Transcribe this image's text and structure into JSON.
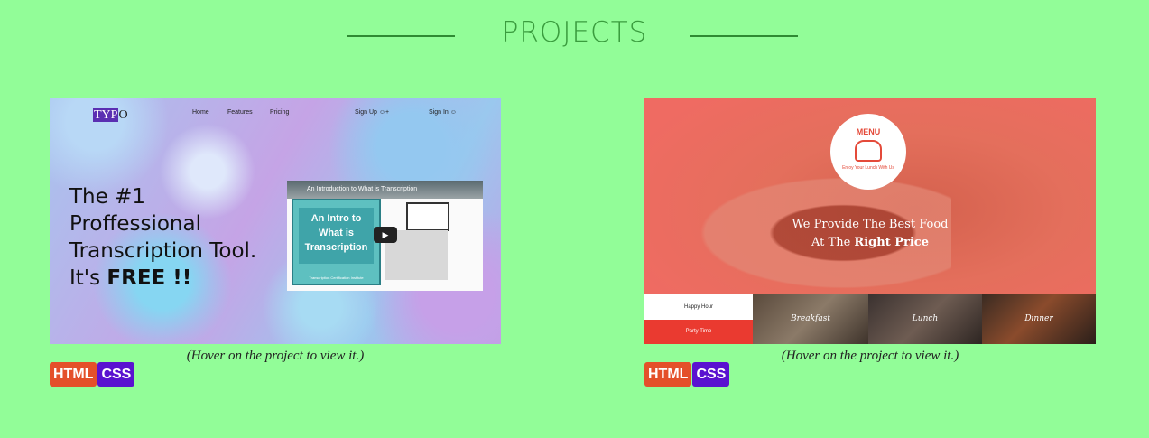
{
  "section": {
    "title": "PROJECTS"
  },
  "projects": [
    {
      "hint": "(Hover on the project to view it.)",
      "tags": [
        "HTML",
        "CSS"
      ],
      "preview": {
        "logo_a": "TYP",
        "logo_b": "O",
        "nav": [
          "Home",
          "Features",
          "Pricing"
        ],
        "signup": "Sign Up",
        "signin": "Sign In",
        "headline_lines": [
          "The #1",
          "Proffessional",
          "Transcription Tool."
        ],
        "headline_free_prefix": "It's ",
        "headline_free": "FREE !!",
        "video_title": "An Introduction to What is Transcription",
        "video_card": "An Intro to What is Transcription",
        "video_footer": "Transcription Certification Institute",
        "play_glyph": "▶"
      }
    },
    {
      "hint": "(Hover on the project to view it.)",
      "tags": [
        "HTML",
        "CSS"
      ],
      "preview": {
        "badge_title": "MENU",
        "badge_sub": "Enjoy Your Lunch With Us",
        "slogan_line1": "We Provide The Best Food",
        "slogan_line2_prefix": "At The ",
        "slogan_line2_bold": "Right Price",
        "tabs": [
          "Happy Hour",
          "Party Time"
        ],
        "categories": [
          "Breakfast",
          "Lunch",
          "Dinner"
        ]
      }
    }
  ],
  "colors": {
    "background": "#92fd98",
    "html_tag": "#e4502a",
    "css_tag": "#5a12d0",
    "title": "#3a9c3e"
  }
}
